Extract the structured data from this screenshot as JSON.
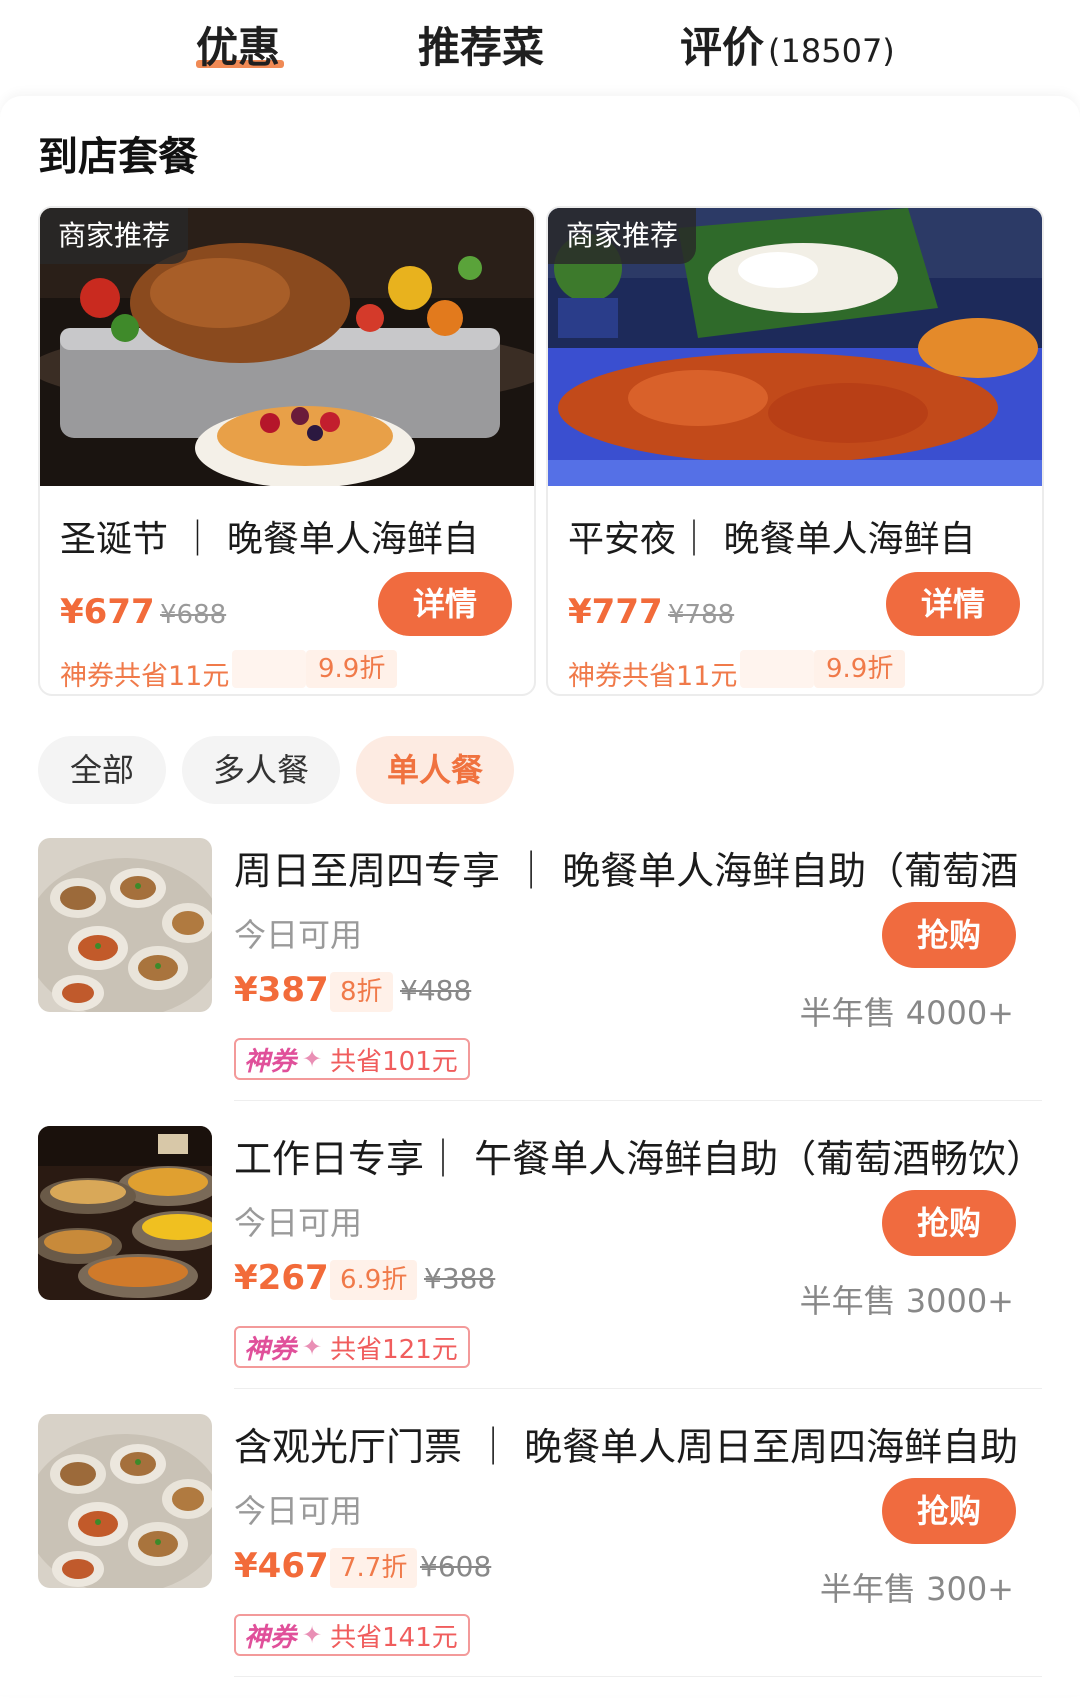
{
  "tabs": {
    "offers": "优惠",
    "recommended": "推荐菜",
    "reviews": "评价",
    "reviews_count": "(18507)"
  },
  "section_title": "到店套餐",
  "packages": [
    {
      "tag": "商家推荐",
      "title": "圣诞节 ｜ 晚餐单人海鲜自",
      "price": "¥677",
      "original_price": "¥688",
      "button": "详情",
      "coupon_save": "神券共省11元",
      "discount": "9.9折"
    },
    {
      "tag": "商家推荐",
      "title": "平安夜｜ 晚餐单人海鲜自",
      "price": "¥777",
      "original_price": "¥788",
      "button": "详情",
      "coupon_save": "神券共省11元",
      "discount": "9.9折"
    }
  ],
  "filters": [
    "全部",
    "多人餐",
    "单人餐"
  ],
  "items": [
    {
      "title": "周日至周四专享 ｜ 晚餐单人海鲜自助（葡萄酒",
      "availability": "今日可用",
      "price": "¥387",
      "discount": "8折",
      "original_price": "¥488",
      "button": "抢购",
      "sold": "半年售 4000+",
      "coupon_label": "神券",
      "coupon_save": "共省101元"
    },
    {
      "title": "工作日专享｜ 午餐单人海鲜自助（葡萄酒畅饮）",
      "availability": "今日可用",
      "price": "¥267",
      "discount": "6.9折",
      "original_price": "¥388",
      "button": "抢购",
      "sold": "半年售 3000+",
      "coupon_label": "神券",
      "coupon_save": "共省121元"
    },
    {
      "title": "含观光厅门票 ｜ 晚餐单人周日至周四海鲜自助",
      "availability": "今日可用",
      "price": "¥467",
      "discount": "7.7折",
      "original_price": "¥608",
      "button": "抢购",
      "sold": "半年售 300+",
      "coupon_label": "神券",
      "coupon_save": "共省141元"
    }
  ],
  "colors": {
    "accent": "#f06b3f",
    "price": "#f26b3a",
    "chip_active_bg": "#fdebe2"
  }
}
